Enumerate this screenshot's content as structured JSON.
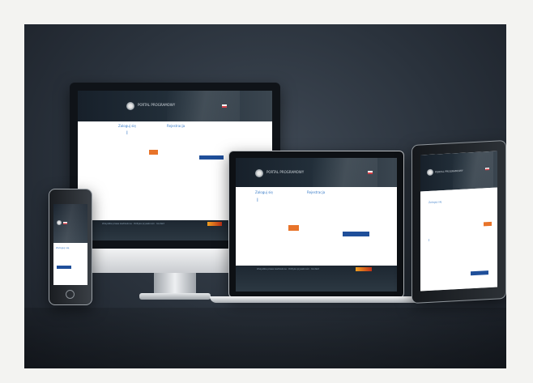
{
  "site": {
    "brand": "PORTAL PROGRAMOWY",
    "brand_small": "PORTAL PROGRAMOWY",
    "nav_left": "Zaloguj się",
    "nav_right": "Rejestracja",
    "cursor": "I",
    "footer": "Wszystkie prawa zastrzeżone · Polityka prywatności · Kontakt"
  },
  "colors": {
    "background": "#2a323c",
    "header": "#1c2630",
    "orange_button": "#e8742a",
    "blue_button": "#1f4f9a",
    "link": "#3a7cc8"
  },
  "icons": {
    "logo": "eagle-emblem-icon",
    "flag": "polish-flag-icon"
  }
}
